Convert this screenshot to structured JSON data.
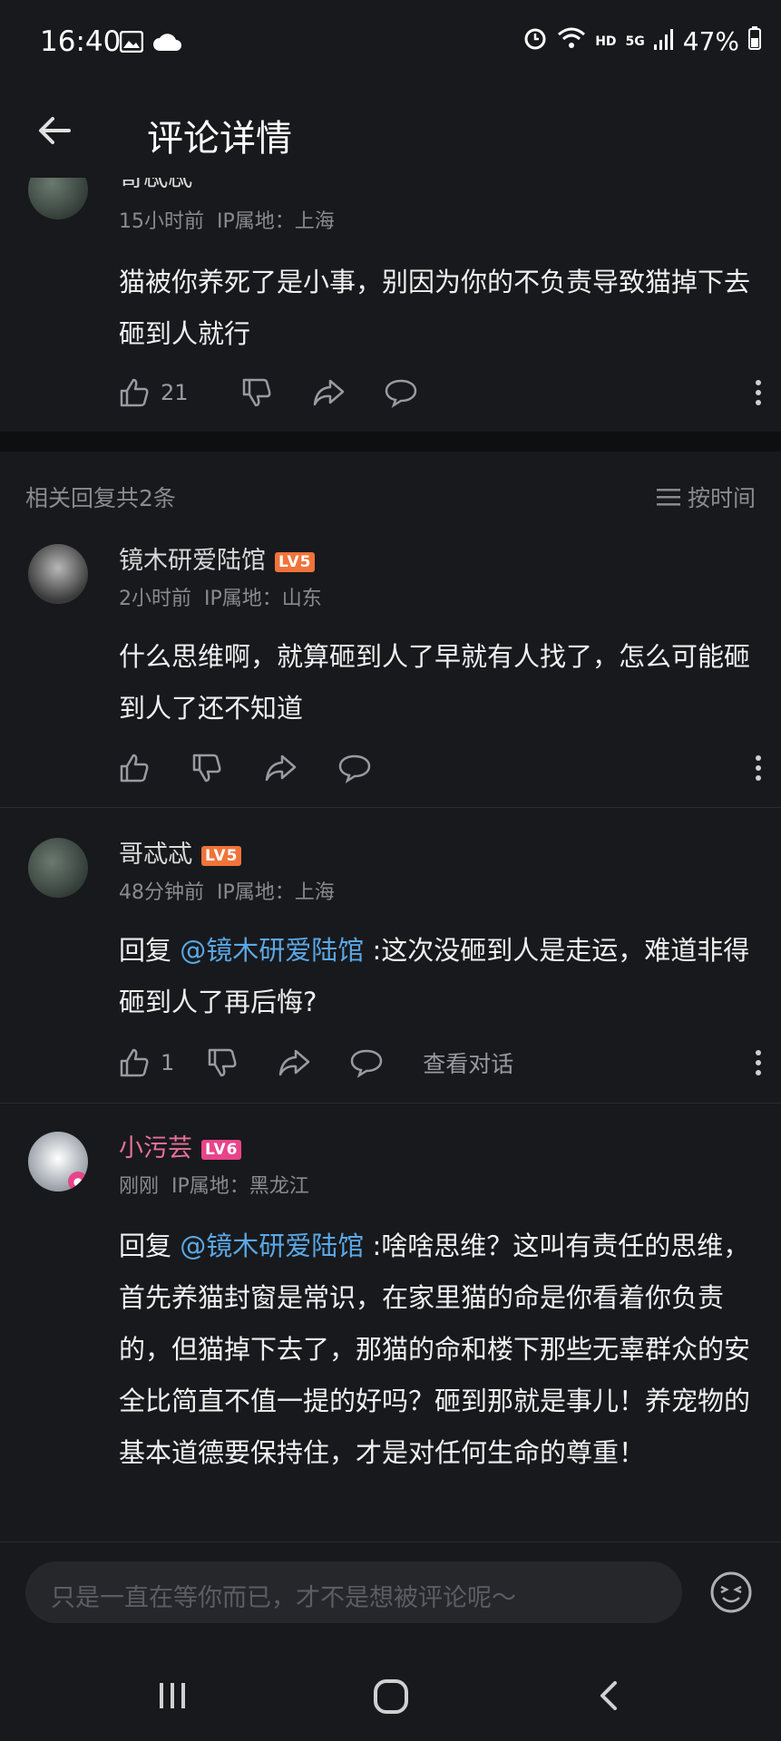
{
  "status_bar": {
    "time": "16:40",
    "network": "HD",
    "signal": "5G",
    "battery": "47%"
  },
  "header": {
    "title": "评论详情"
  },
  "main_comment": {
    "username": "哥忒忒",
    "time": "15小时前",
    "ip": "IP属地：上海",
    "content": "猫被你养死了是小事，别因为你的不负责导致猫掉下去砸到人就行",
    "likes": "21"
  },
  "replies_header": {
    "count_label": "相关回复共2条",
    "sort_label": "按时间"
  },
  "replies": [
    {
      "username": "镜木研爱陆馆",
      "level": "LV5",
      "time": "2小时前",
      "ip": "IP属地：山东",
      "content": "什么思维啊，就算砸到人了早就有人找了，怎么可能砸到人了还不知道"
    },
    {
      "username": "哥忒忒",
      "level": "LV5",
      "time": "48分钟前",
      "ip": "IP属地：上海",
      "reply_prefix": "回复 ",
      "mention": "@镜木研爱陆馆",
      "content": " :这次没砸到人是走运，难道非得砸到人了再后悔?",
      "likes": "1",
      "view_dialog": "查看对话"
    },
    {
      "username": "小污芸",
      "level": "LV6",
      "time": "刚刚",
      "ip": "IP属地：黑龙江",
      "reply_prefix": "回复 ",
      "mention": "@镜木研爱陆馆",
      "content": " :啥啥思维？这叫有责任的思维，首先养猫封窗是常识，在家里猫的命是你看着你负责的，但猫掉下去了，那猫的命和楼下那些无辜群众的安全比简直不值一提的好吗？砸到那就是事儿！养宠物的基本道德要保持住，才是对任何生命的尊重！"
    }
  ],
  "input": {
    "placeholder": "只是一直在等你而已，才不是想被评论呢～"
  },
  "colors": {
    "background": "#18191c",
    "mention": "#5aa8e6",
    "lv5": "#f0733a",
    "lv6": "#e8448a",
    "username_pink": "#e8709a"
  }
}
